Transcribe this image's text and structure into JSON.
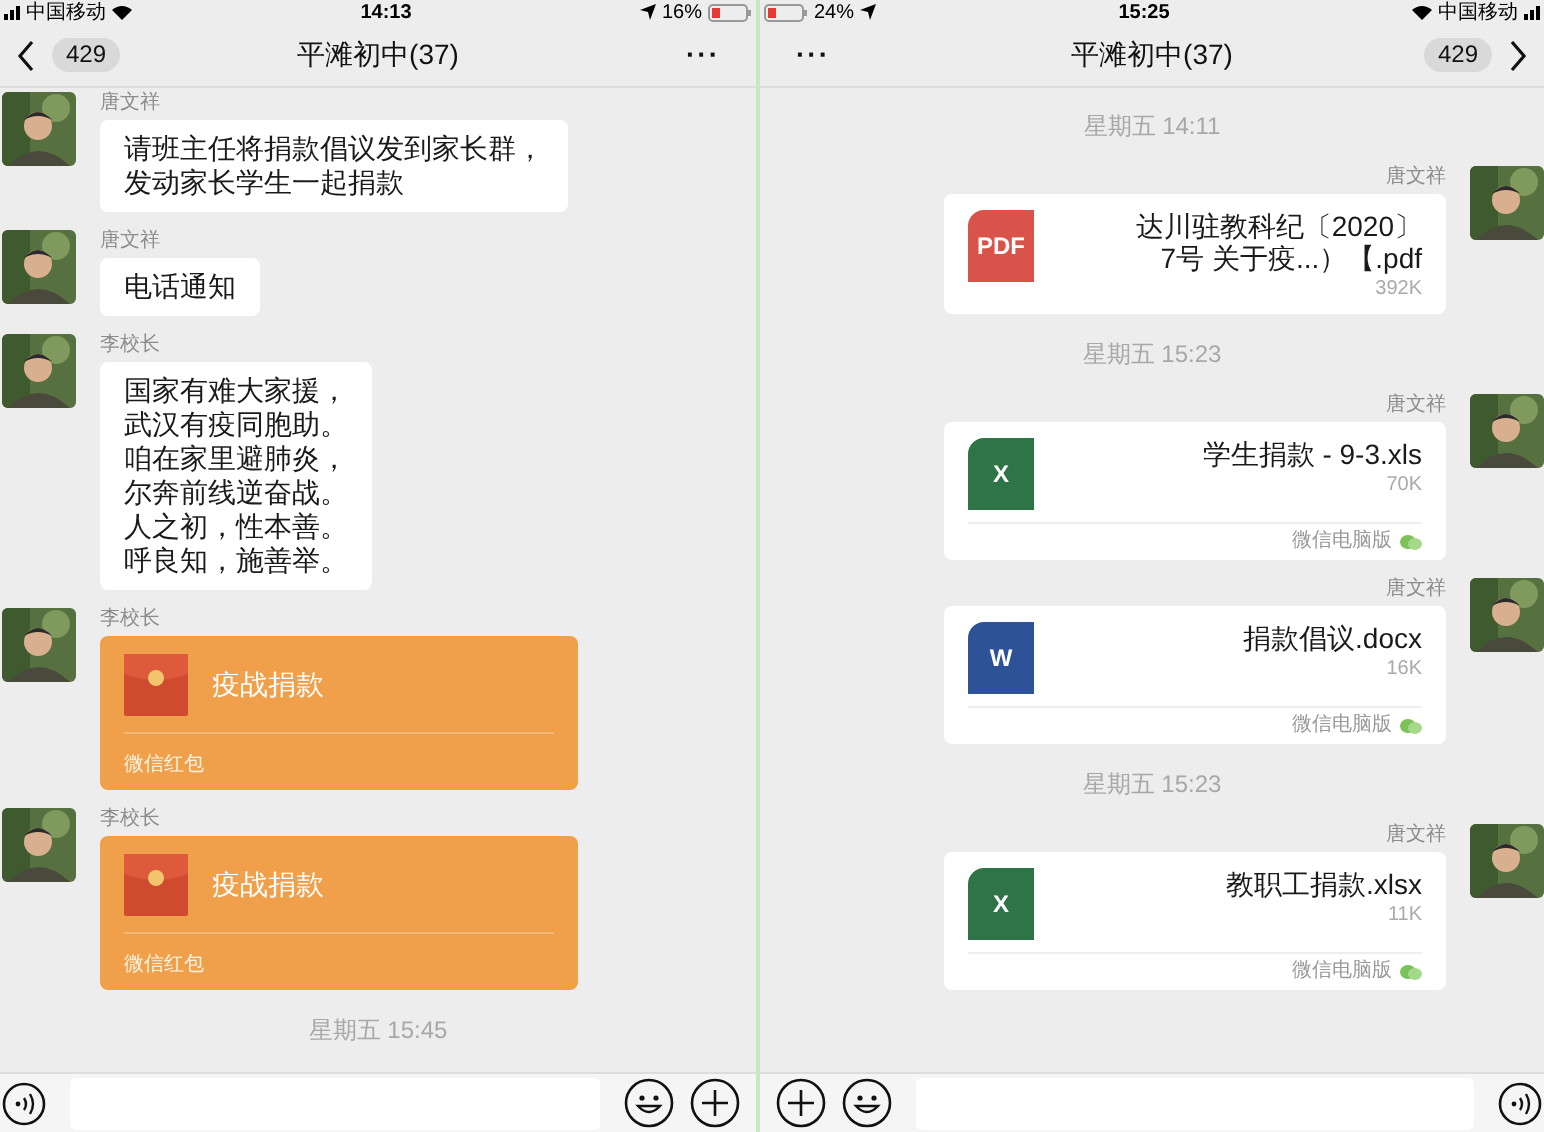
{
  "phones": [
    {
      "mirrored": false,
      "status_bar": {
        "carrier": "中国移动",
        "time": "14:13",
        "battery": "16%"
      },
      "nav": {
        "back_count": "429",
        "title": "平滩初中(37)",
        "more": "···"
      },
      "messages": [
        {
          "kind": "text",
          "sender": "唐文祥",
          "lines": [
            "请班主任将捐款倡议发到家长群，",
            "发动家长学生一起捐款"
          ]
        },
        {
          "kind": "text",
          "sender": "唐文祥",
          "lines": [
            "电话通知"
          ]
        },
        {
          "kind": "text",
          "sender": "李校长",
          "lines": [
            "国家有难大家援，",
            "武汉有疫同胞助。",
            "咱在家里避肺炎，",
            "尔奔前线逆奋战。",
            "人之初，性本善。",
            "呼良知，施善举。"
          ]
        },
        {
          "kind": "redpacket",
          "sender": "李校长",
          "title": "疫战捐款",
          "footer": "微信红包"
        },
        {
          "kind": "redpacket",
          "sender": "李校长",
          "title": "疫战捐款",
          "footer": "微信红包"
        },
        {
          "kind": "time",
          "text": "星期五 15:45"
        }
      ]
    },
    {
      "mirrored": true,
      "status_bar": {
        "carrier": "中国移动",
        "time": "15:25",
        "battery": "24%"
      },
      "nav": {
        "back_count": "429",
        "title": "平滩初中(37)",
        "more": "···"
      },
      "messages": [
        {
          "kind": "time",
          "text": "星期五 14:11"
        },
        {
          "kind": "file",
          "sender": "唐文祥",
          "color": "#d9534a",
          "icon_label": "PDF",
          "lines": [
            "达川驻教科纪〔2020〕",
            "7号 关于疫...）【.pdf"
          ],
          "size": "392K"
        },
        {
          "kind": "time",
          "text": "星期五 15:23"
        },
        {
          "kind": "file",
          "sender": "唐文祥",
          "color": "#2f7446",
          "icon_label": "X",
          "lines": [
            "学生捐款 - 9-3.xls"
          ],
          "size": "70K",
          "footer": "微信电脑版"
        },
        {
          "kind": "file",
          "sender": "唐文祥",
          "color": "#2d5297",
          "icon_label": "W",
          "lines": [
            "捐款倡议.docx"
          ],
          "size": "16K",
          "footer": "微信电脑版"
        },
        {
          "kind": "time",
          "text": "星期五 15:23"
        },
        {
          "kind": "file",
          "sender": "唐文祥",
          "color": "#2f7446",
          "icon_label": "X",
          "lines": [
            "教职工捐款.xlsx"
          ],
          "size": "11K",
          "footer": "微信电脑版"
        }
      ]
    }
  ]
}
